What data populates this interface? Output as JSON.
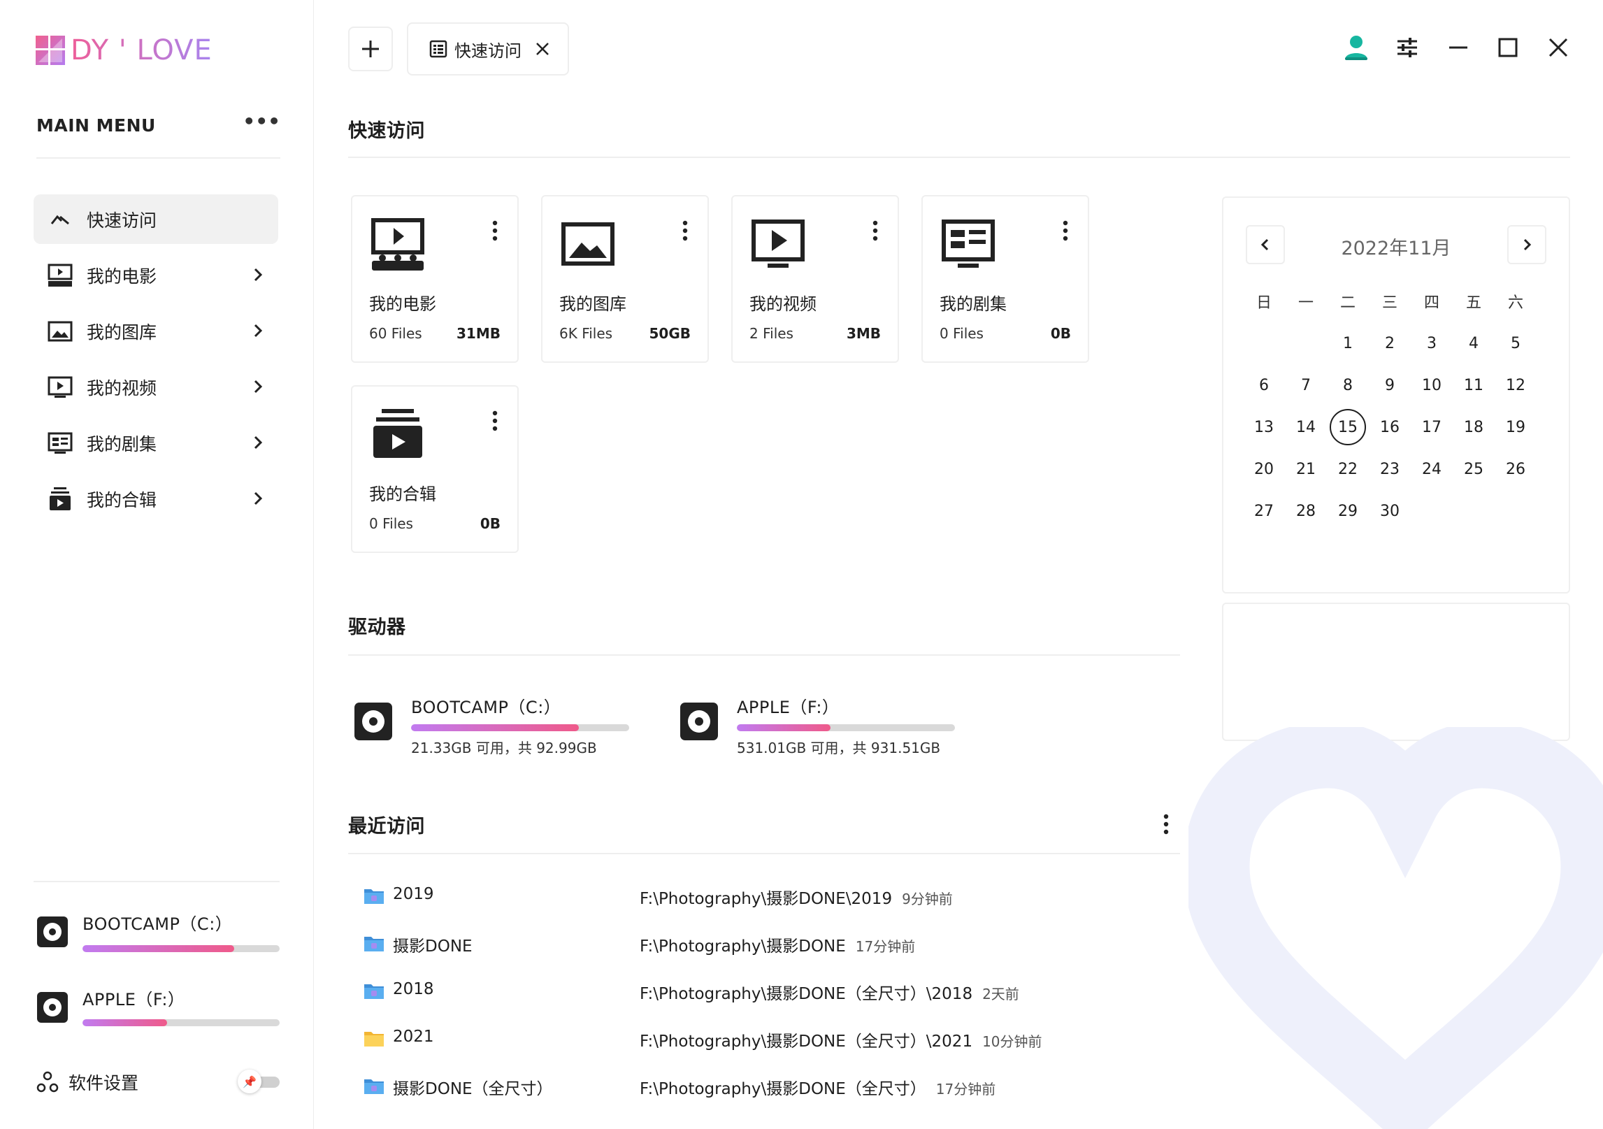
{
  "app": {
    "logo_text": "DY ' LOVE"
  },
  "sidebar": {
    "menu_title": "MAIN MENU",
    "menu_more": "•••",
    "items": [
      {
        "label": "快速访问",
        "icon": "chevron-up-icon",
        "active": true
      },
      {
        "label": "我的电影",
        "icon": "movie-icon"
      },
      {
        "label": "我的图库",
        "icon": "image-icon"
      },
      {
        "label": "我的视频",
        "icon": "video-icon"
      },
      {
        "label": "我的剧集",
        "icon": "series-icon"
      },
      {
        "label": "我的合辑",
        "icon": "collection-icon"
      }
    ],
    "drives": [
      {
        "name": "BOOTCAMP（C:）",
        "fill": 0.77
      },
      {
        "name": "APPLE（F:）",
        "fill": 0.43
      }
    ],
    "settings_label": "软件设置"
  },
  "tabs": {
    "active_tab": "快速访问"
  },
  "quick_access": {
    "title": "快速访问",
    "cards": [
      {
        "name": "我的电影",
        "files": "60 Files",
        "size": "31MB",
        "icon": "movie-icon"
      },
      {
        "name": "我的图库",
        "files": "6K Files",
        "size": "50GB",
        "icon": "image-icon"
      },
      {
        "name": "我的视频",
        "files": "2 Files",
        "size": "3MB",
        "icon": "video-icon"
      },
      {
        "name": "我的剧集",
        "files": "0 Files",
        "size": "0B",
        "icon": "series-icon"
      },
      {
        "name": "我的合辑",
        "files": "0 Files",
        "size": "0B",
        "icon": "collection-icon"
      }
    ]
  },
  "drives_section": {
    "title": "驱动器",
    "drives": [
      {
        "name": "BOOTCAMP（C:）",
        "info": "21.33GB 可用，共 92.99GB",
        "fill": 0.77
      },
      {
        "name": "APPLE（F:）",
        "info": "531.01GB 可用，共 931.51GB",
        "fill": 0.43
      }
    ]
  },
  "recent": {
    "title": "最近访问",
    "rows": [
      {
        "name": "2019",
        "path": "F:\\Photography\\摄影DONE\\2019",
        "time": "9分钟前",
        "icon": "folder-blue-icon"
      },
      {
        "name": "摄影DONE",
        "path": "F:\\Photography\\摄影DONE",
        "time": "17分钟前",
        "icon": "folder-blue-icon"
      },
      {
        "name": "2018",
        "path": "F:\\Photography\\摄影DONE（全尺寸）\\2018",
        "time": "2天前",
        "icon": "folder-blue-icon"
      },
      {
        "name": "2021",
        "path": "F:\\Photography\\摄影DONE（全尺寸）\\2021",
        "time": "10分钟前",
        "icon": "folder-yellow-icon"
      },
      {
        "name": "摄影DONE（全尺寸）",
        "path": "F:\\Photography\\摄影DONE（全尺寸）",
        "time": "17分钟前",
        "icon": "folder-blue-icon"
      }
    ]
  },
  "calendar": {
    "month_label": "2022年11月",
    "weekdays": [
      "日",
      "一",
      "二",
      "三",
      "四",
      "五",
      "六"
    ],
    "days": [
      "",
      "",
      "1",
      "2",
      "3",
      "4",
      "5",
      "6",
      "7",
      "8",
      "9",
      "10",
      "11",
      "12",
      "13",
      "14",
      "15",
      "16",
      "17",
      "18",
      "19",
      "20",
      "21",
      "22",
      "23",
      "24",
      "25",
      "26",
      "27",
      "28",
      "29",
      "30",
      "",
      "",
      ""
    ],
    "today": "15"
  },
  "colors": {
    "accent_pink": "#ef5a8a",
    "accent_purple": "#c17bf0",
    "avatar_teal": "#17b6a0",
    "heart_bg": "#eef0fb"
  }
}
